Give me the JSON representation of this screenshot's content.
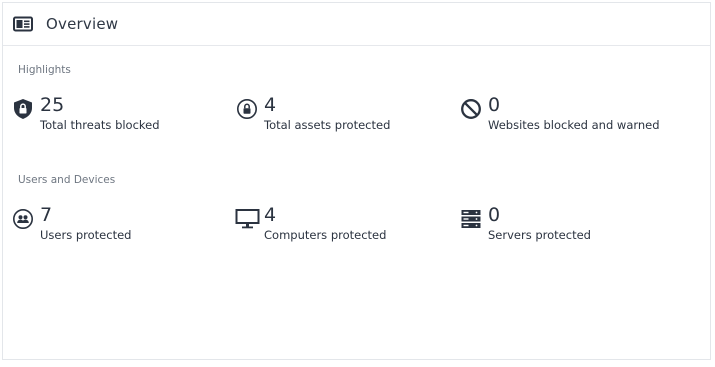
{
  "header": {
    "title": "Overview",
    "icon": "overview-card-icon"
  },
  "sections": [
    {
      "label": "Highlights",
      "stats": [
        {
          "value": "25",
          "label": "Total threats blocked",
          "icon": "shield-lock-icon"
        },
        {
          "value": "4",
          "label": "Total assets protected",
          "icon": "lock-circle-icon"
        },
        {
          "value": "0",
          "label": "Websites blocked and warned",
          "icon": "blocked-icon"
        }
      ]
    },
    {
      "label": "Users and Devices",
      "stats": [
        {
          "value": "7",
          "label": "Users protected",
          "icon": "users-circle-icon"
        },
        {
          "value": "4",
          "label": "Computers protected",
          "icon": "monitor-icon"
        },
        {
          "value": "0",
          "label": "Servers protected",
          "icon": "server-icon"
        }
      ]
    }
  ],
  "colors": {
    "text": "#2b3340",
    "muted": "#6e7681",
    "border": "#e3e6ea"
  }
}
